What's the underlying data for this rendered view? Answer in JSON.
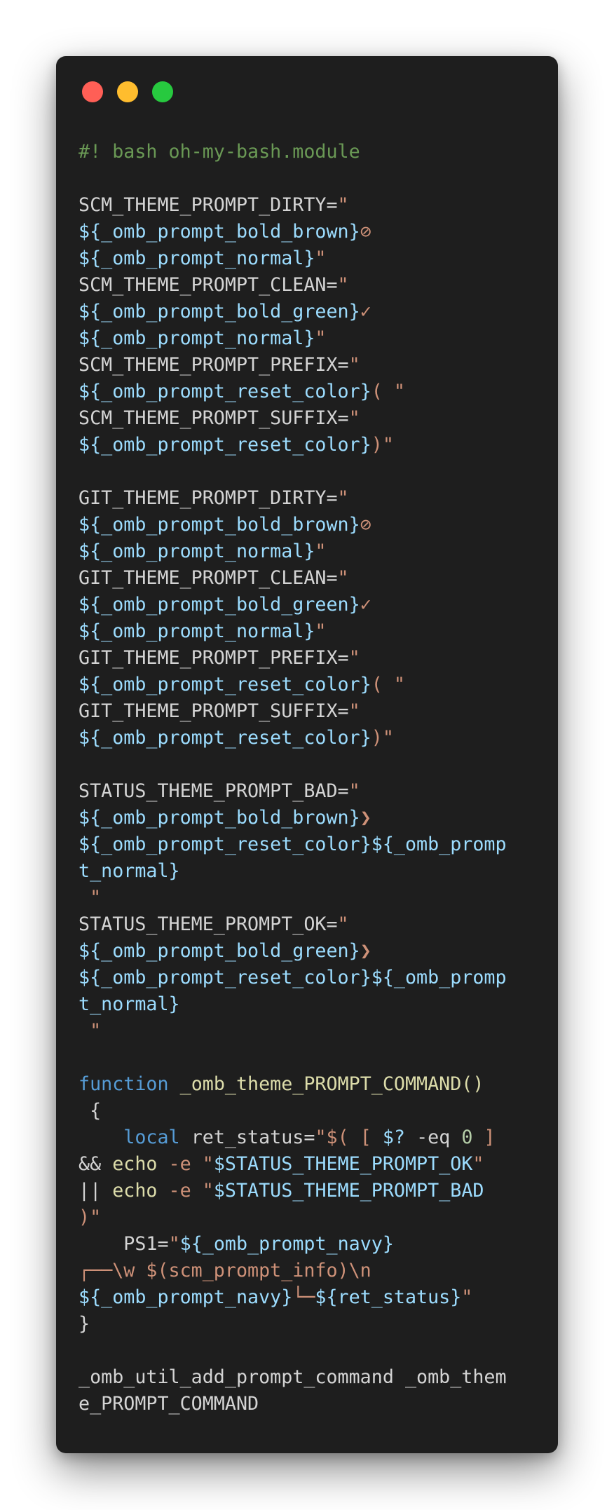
{
  "window": {
    "buttons": {
      "close": "close",
      "minimize": "minimize",
      "maximize": "maximize"
    }
  },
  "code": {
    "header": "#! bash oh-my-bash.module",
    "scm": {
      "dirty_assign": "SCM_THEME_PROMPT_DIRTY=",
      "clean_assign": "SCM_THEME_PROMPT_CLEAN=",
      "prefix_assign": "SCM_THEME_PROMPT_PREFIX=",
      "suffix_assign": "SCM_THEME_PROMPT_SUFFIX="
    },
    "git": {
      "dirty_assign": "GIT_THEME_PROMPT_DIRTY=",
      "clean_assign": "GIT_THEME_PROMPT_CLEAN=",
      "prefix_assign": "GIT_THEME_PROMPT_PREFIX=",
      "suffix_assign": "GIT_THEME_PROMPT_SUFFIX="
    },
    "status": {
      "bad_assign": "STATUS_THEME_PROMPT_BAD=",
      "ok_assign": "STATUS_THEME_PROMPT_OK="
    },
    "vars": {
      "bold_brown": "${_omb_prompt_bold_brown}",
      "bold_green": "${_omb_prompt_bold_green}",
      "normal": "${_omb_prompt_normal}",
      "reset_color": "${_omb_prompt_reset_color}",
      "reset_normal_1": "${_omb_prompt_reset_color}${_omb_promp",
      "reset_normal_2": "t_normal}",
      "navy": "${_omb_prompt_navy}",
      "ret_status": "${ret_status}",
      "status_ok": "$STATUS_THEME_PROMPT_OK",
      "status_bad": "$STATUS_THEME_PROMPT_BAD",
      "qmark": "$?"
    },
    "glyphs": {
      "dirty": "⊘",
      "clean": "✓",
      "arrow": "❯",
      "corner_top": "┌──",
      "corner_bottom": "└─"
    },
    "strings": {
      "quote": "\"",
      "open_paren": "( \"",
      "close_paren": ")\"",
      "space_quote": " \"",
      "subshell_open": "$( [ ",
      "eq": " -eq ",
      "close_bracket": " ]",
      "echo_flag": " -e ",
      "end_subshell": ")\"",
      "ps1_mid": "\\w $(scm_prompt_info)\\n"
    },
    "function": {
      "keyword": "function",
      "name": "_omb_theme_PROMPT_COMMAND()",
      "open_brace": " {",
      "local": "local",
      "ret_status": " ret_status=",
      "and": "&& ",
      "or": "|| ",
      "echo": "echo",
      "zero": "0",
      "ps1": "PS1=",
      "close_brace": "}"
    },
    "footer_1": "_omb_util_add_prompt_command _omb_them",
    "footer_2": "e_PROMPT_COMMAND"
  }
}
